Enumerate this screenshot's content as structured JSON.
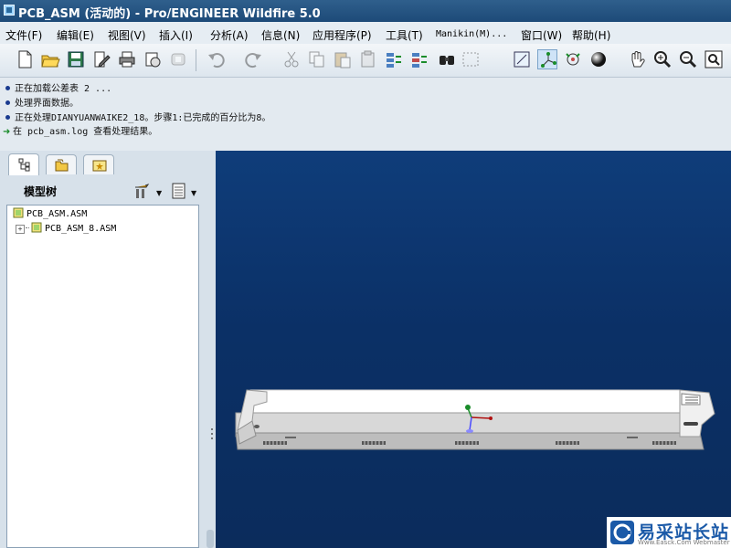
{
  "window": {
    "title": "PCB_ASM (活动的) - Pro/ENGINEER Wildfire 5.0"
  },
  "menu": [
    "文件(F)",
    "编辑(E)",
    "视图(V)",
    "插入(I)",
    "分析(A)",
    "信息(N)",
    "应用程序(P)",
    "工具(T)",
    "Manikin(M)...",
    "窗口(W)",
    "帮助(H)"
  ],
  "toolbar": {
    "icons": [
      "new-file-icon",
      "open-folder-icon",
      "save-icon",
      "edit-icon",
      "print-icon",
      "copy-disk-icon",
      "erase-icon",
      "undo-icon",
      "redo-icon",
      "cut-icon",
      "copy-icon",
      "paste-icon",
      "paste-special-icon",
      "regenerate-icon",
      "regen-manager-icon",
      "find-icon",
      "select-box-icon",
      "layer-view-icon",
      "datum-axes-icon",
      "spin-center-icon",
      "shading-icon",
      "pan-hand-icon",
      "zoom-in-icon",
      "zoom-out-icon",
      "refit-icon"
    ]
  },
  "messages": [
    {
      "type": "info",
      "text": "正在加载公差表 2 ..."
    },
    {
      "type": "info",
      "text": "处理界面数据。"
    },
    {
      "type": "info",
      "text": "正在处理DIANYUANWAIKE2_18。步骤1:已完成的百分比为8。"
    },
    {
      "type": "prompt",
      "text": "在 pcb_asm.log 查看处理结果。"
    }
  ],
  "left_panel": {
    "tabs": [
      "model-tree-tab",
      "folder-browser-tab",
      "favorites-tab"
    ],
    "tree_title": "模型树",
    "tree": [
      {
        "label": "PCB_ASM.ASM",
        "level": 0,
        "expandable": false
      },
      {
        "label": "PCB_ASM_8.ASM",
        "level": 1,
        "expandable": true,
        "expander": "+"
      }
    ]
  },
  "watermark": {
    "text": "易采站长站",
    "sub": "Www.Easck.Com  Webmaster"
  },
  "colors": {
    "viewport": "#0b3066",
    "titlebar": "#2f5f8c",
    "model": "#ffffff"
  }
}
